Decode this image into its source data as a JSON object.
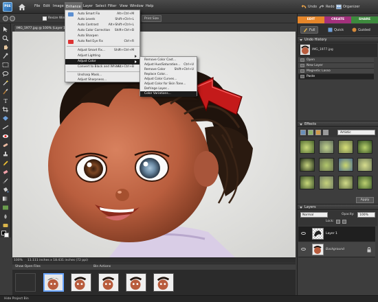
{
  "app": {
    "logo_text": "PSE"
  },
  "menu": {
    "items": [
      "File",
      "Edit",
      "Image",
      "Enhance",
      "Layer",
      "Select",
      "Filter",
      "View",
      "Window",
      "Help"
    ],
    "active": "Enhance"
  },
  "top_right": {
    "undo": "Undo",
    "redo": "Redo",
    "organizer": "Organizer"
  },
  "options_bar": {
    "resize_label": "Resize Windo",
    "print_size": "Print Size"
  },
  "document": {
    "tab_title": "IMG_1977.jpg @ 100% (Layer 1, RGB",
    "zoom": "100%",
    "status": "11.111 inches x 18.431 inches (72 ppi)"
  },
  "enhance_menu": {
    "auto_smart_fix": {
      "label": "Auto Smart Fix",
      "shortcut": "Alt+Ctrl+M"
    },
    "auto_levels": {
      "label": "Auto Levels",
      "shortcut": "Shift+Ctrl+L"
    },
    "auto_contrast": {
      "label": "Auto Contrast",
      "shortcut": "Alt+Shift+Ctrl+L"
    },
    "auto_color": {
      "label": "Auto Color Correction",
      "shortcut": "Shift+Ctrl+B"
    },
    "auto_sharpen": {
      "label": "Auto Sharpen",
      "shortcut": ""
    },
    "auto_red_eye": {
      "label": "Auto Red Eye Fix",
      "shortcut": "Ctrl+R"
    },
    "adjust_smart_fix": {
      "label": "Adjust Smart Fix...",
      "shortcut": "Shift+Ctrl+M"
    },
    "adjust_lighting": {
      "label": "Adjust Lighting",
      "shortcut": ""
    },
    "adjust_color": {
      "label": "Adjust Color",
      "shortcut": ""
    },
    "convert_bw": {
      "label": "Convert to Black and White...",
      "shortcut": "Alt+Ctrl+B"
    },
    "unsharp_mask": {
      "label": "Unsharp Mask...",
      "shortcut": ""
    },
    "adjust_sharpness": {
      "label": "Adjust Sharpness...",
      "shortcut": ""
    }
  },
  "adjust_color_submenu": {
    "remove_color_cast": {
      "label": "Remove Color Cast...",
      "shortcut": ""
    },
    "hue_saturation": {
      "label": "Adjust Hue/Saturation...",
      "shortcut": "Ctrl+U"
    },
    "remove_color": {
      "label": "Remove Color",
      "shortcut": "Shift+Ctrl+U"
    },
    "replace_color": {
      "label": "Replace Color...",
      "shortcut": ""
    },
    "color_curves": {
      "label": "Adjust Color Curves...",
      "shortcut": ""
    },
    "skin_tone": {
      "label": "Adjust Color for Skin Tone...",
      "shortcut": ""
    },
    "defringe": {
      "label": "Defringe Layer...",
      "shortcut": ""
    },
    "color_variations": {
      "label": "Color Variations...",
      "shortcut": ""
    }
  },
  "mode_tabs": {
    "edit": "EDIT",
    "create": "CREATE",
    "share": "SHARE"
  },
  "mode_colors": {
    "edit": "#e6862a",
    "create": "#a3307c",
    "share": "#3d8a3d"
  },
  "edit_tabs": {
    "full": "Full",
    "quick": "Quick",
    "guided": "Guided"
  },
  "undo_history": {
    "title": "Undo History",
    "items": [
      "IMG_1977.jpg",
      "Open",
      "New Layer",
      "Magnetic Lasso",
      "Paste"
    ]
  },
  "effects": {
    "title": "Effects",
    "filter": "Artistic",
    "apply": "Apply"
  },
  "layers": {
    "title": "Layers",
    "blend_mode": "Normal",
    "opacity_label": "Opacity:",
    "opacity_value": "100%",
    "lock_label": "Lock:",
    "items": [
      "Layer 1",
      "Background"
    ]
  },
  "project_bin": {
    "show_label": "Show Open Files",
    "actions_label": "Bin Actions",
    "hide_label": "Hide Project Bin"
  }
}
